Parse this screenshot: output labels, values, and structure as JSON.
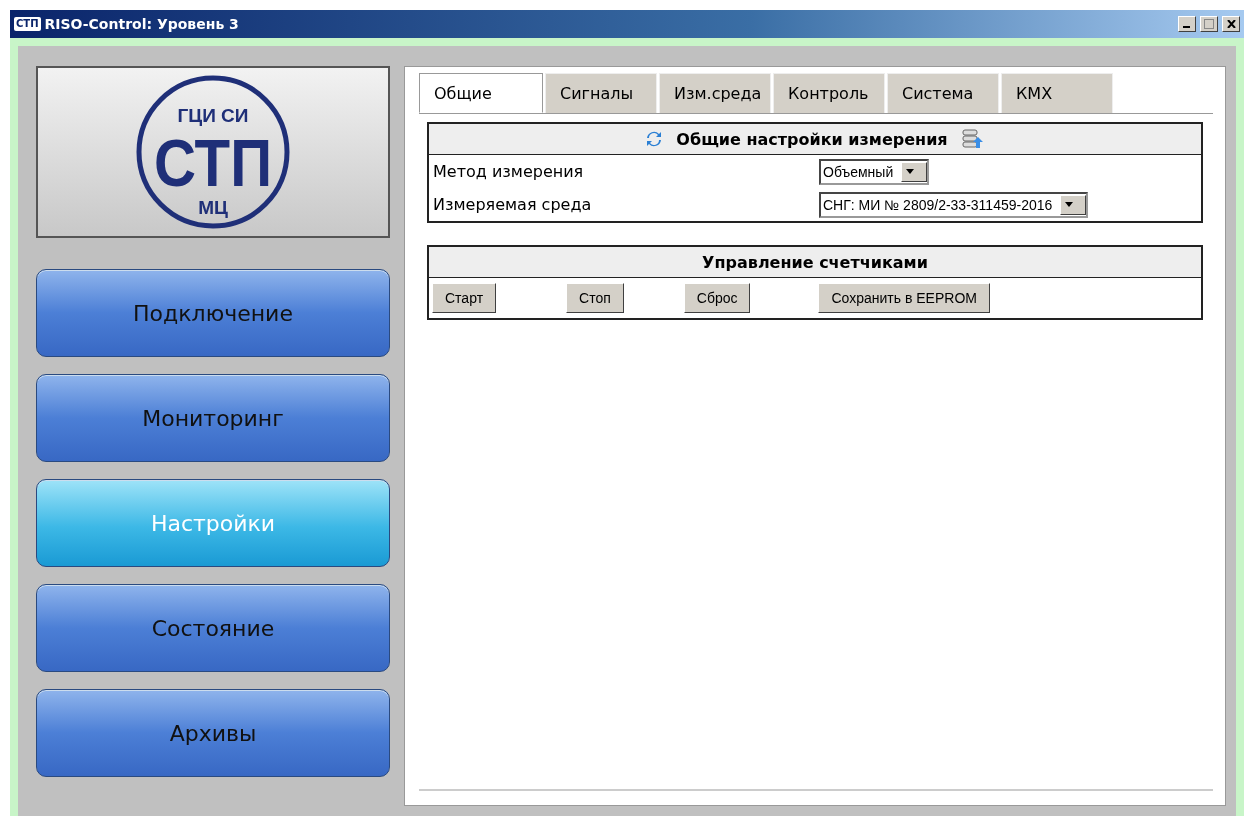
{
  "window": {
    "title": "RISO-Control: Уровень 3",
    "icon_text": "СТП"
  },
  "logo": {
    "top": "ГЦИ СИ",
    "middle": "СТП",
    "bottom": "МЦ"
  },
  "nav": [
    {
      "label": "Подключение",
      "selected": false
    },
    {
      "label": "Мониторинг",
      "selected": false
    },
    {
      "label": "Настройки",
      "selected": true
    },
    {
      "label": "Состояние",
      "selected": false
    },
    {
      "label": "Архивы",
      "selected": false
    }
  ],
  "tabs": [
    {
      "label": "Общие",
      "selected": true
    },
    {
      "label": "Сигналы",
      "selected": false
    },
    {
      "label": "Изм.среда",
      "selected": false
    },
    {
      "label": "Контроль",
      "selected": false
    },
    {
      "label": "Система",
      "selected": false
    },
    {
      "label": "КМХ",
      "selected": false
    }
  ],
  "settings": {
    "title": "Общие настройки измерения",
    "fields": [
      {
        "label": "Метод измерения",
        "value": "Объемный"
      },
      {
        "label": "Измеряемая среда",
        "value": "СНГ: МИ № 2809/2-33-311459-2016"
      }
    ]
  },
  "counters": {
    "title": "Управление счетчиками",
    "buttons": [
      "Старт",
      "Стоп",
      "Сброс",
      "Сохранить в EEPROM"
    ]
  }
}
